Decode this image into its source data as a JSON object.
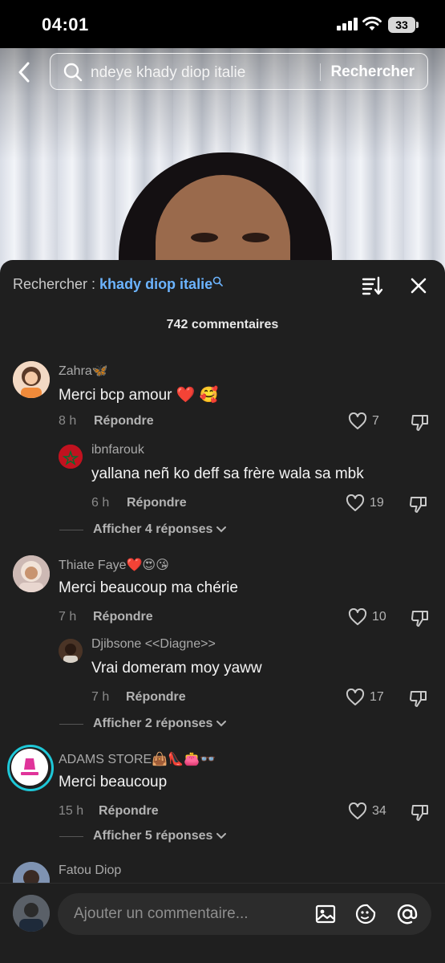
{
  "status": {
    "time": "04:01",
    "battery": "33"
  },
  "search": {
    "query": "ndeye khady diop italie",
    "button": "Rechercher"
  },
  "sheet": {
    "search_prefix": "Rechercher : ",
    "search_term": "khady diop italie",
    "count_label": "742 commentaires"
  },
  "comments": [
    {
      "user": "Zahra🦋",
      "text": "Merci bcp amour ❤️ 🥰",
      "time": "8 h",
      "reply": "Répondre",
      "likes": "7"
    },
    {
      "user": "ibnfarouk",
      "text": "yallana neñ ko deff sa frère wala sa mbk",
      "time": "6 h",
      "reply": "Répondre",
      "likes": "19"
    },
    {
      "more": "Afficher 4 réponses"
    },
    {
      "user": "Thiate Faye❤️😍😘",
      "text": "Merci beaucoup ma chérie",
      "time": "7 h",
      "reply": "Répondre",
      "likes": "10"
    },
    {
      "user": "Djibsone <<Diagne>>",
      "text": "Vrai domeram moy yaww",
      "time": "7 h",
      "reply": "Répondre",
      "likes": "17"
    },
    {
      "more": "Afficher 2 réponses"
    },
    {
      "user": "ADAMS STORE👜👠👛👓",
      "text": "Merci beaucoup",
      "time": "15 h",
      "reply": "Répondre",
      "likes": "34"
    },
    {
      "more": "Afficher 5 réponses"
    },
    {
      "user": "Fatou Diop"
    }
  ],
  "input": {
    "placeholder": "Ajouter un commentaire..."
  },
  "colors": {
    "accent": "#6cb4ff",
    "sheet_bg": "#1f1f1f",
    "ring": "#1ec8d8"
  }
}
